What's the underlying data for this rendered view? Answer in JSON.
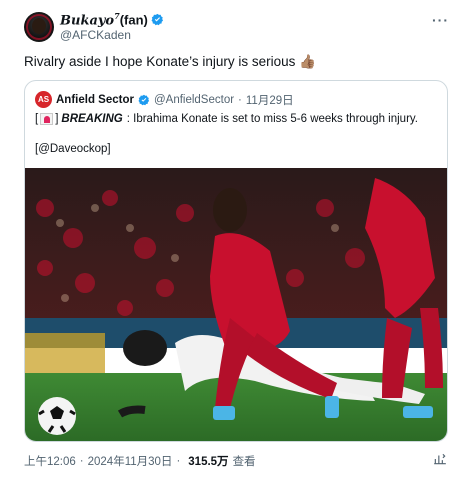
{
  "tweet": {
    "author_display_prefix": "Bukayo",
    "author_display_sup": "7",
    "author_display_suffix": "(fan)",
    "handle": "@AFCKaden",
    "text": "Rivalry aside I hope Konate’s injury is serious 👍🏽",
    "more_label": "···"
  },
  "quote": {
    "avatar_text": "AS",
    "author": "Anfield Sector",
    "handle": "@AnfieldSector",
    "separator": "·",
    "date": "11月29日",
    "bracket_open": "[",
    "bracket_close": "]",
    "breaking_label": "BREAKING",
    "text": ": Ibrahima Konate is set to miss 5-6 weeks through injury.",
    "credit": "[@Daveockop]"
  },
  "footer": {
    "time": "上午12:06",
    "separator1": "·",
    "date": "2024年11月30日",
    "separator2": "·",
    "views": "315.5万",
    "views_label": "查看"
  },
  "colors": {
    "verified": "#1d9bf0",
    "liverpool_red": "#c8102e",
    "pitch": "#2f7a2a",
    "text_secondary": "#536471"
  },
  "icons": {
    "verified": "verified-badge-icon",
    "more": "more-dots-icon",
    "siren": "siren-icon",
    "stats": "stats-icon"
  }
}
